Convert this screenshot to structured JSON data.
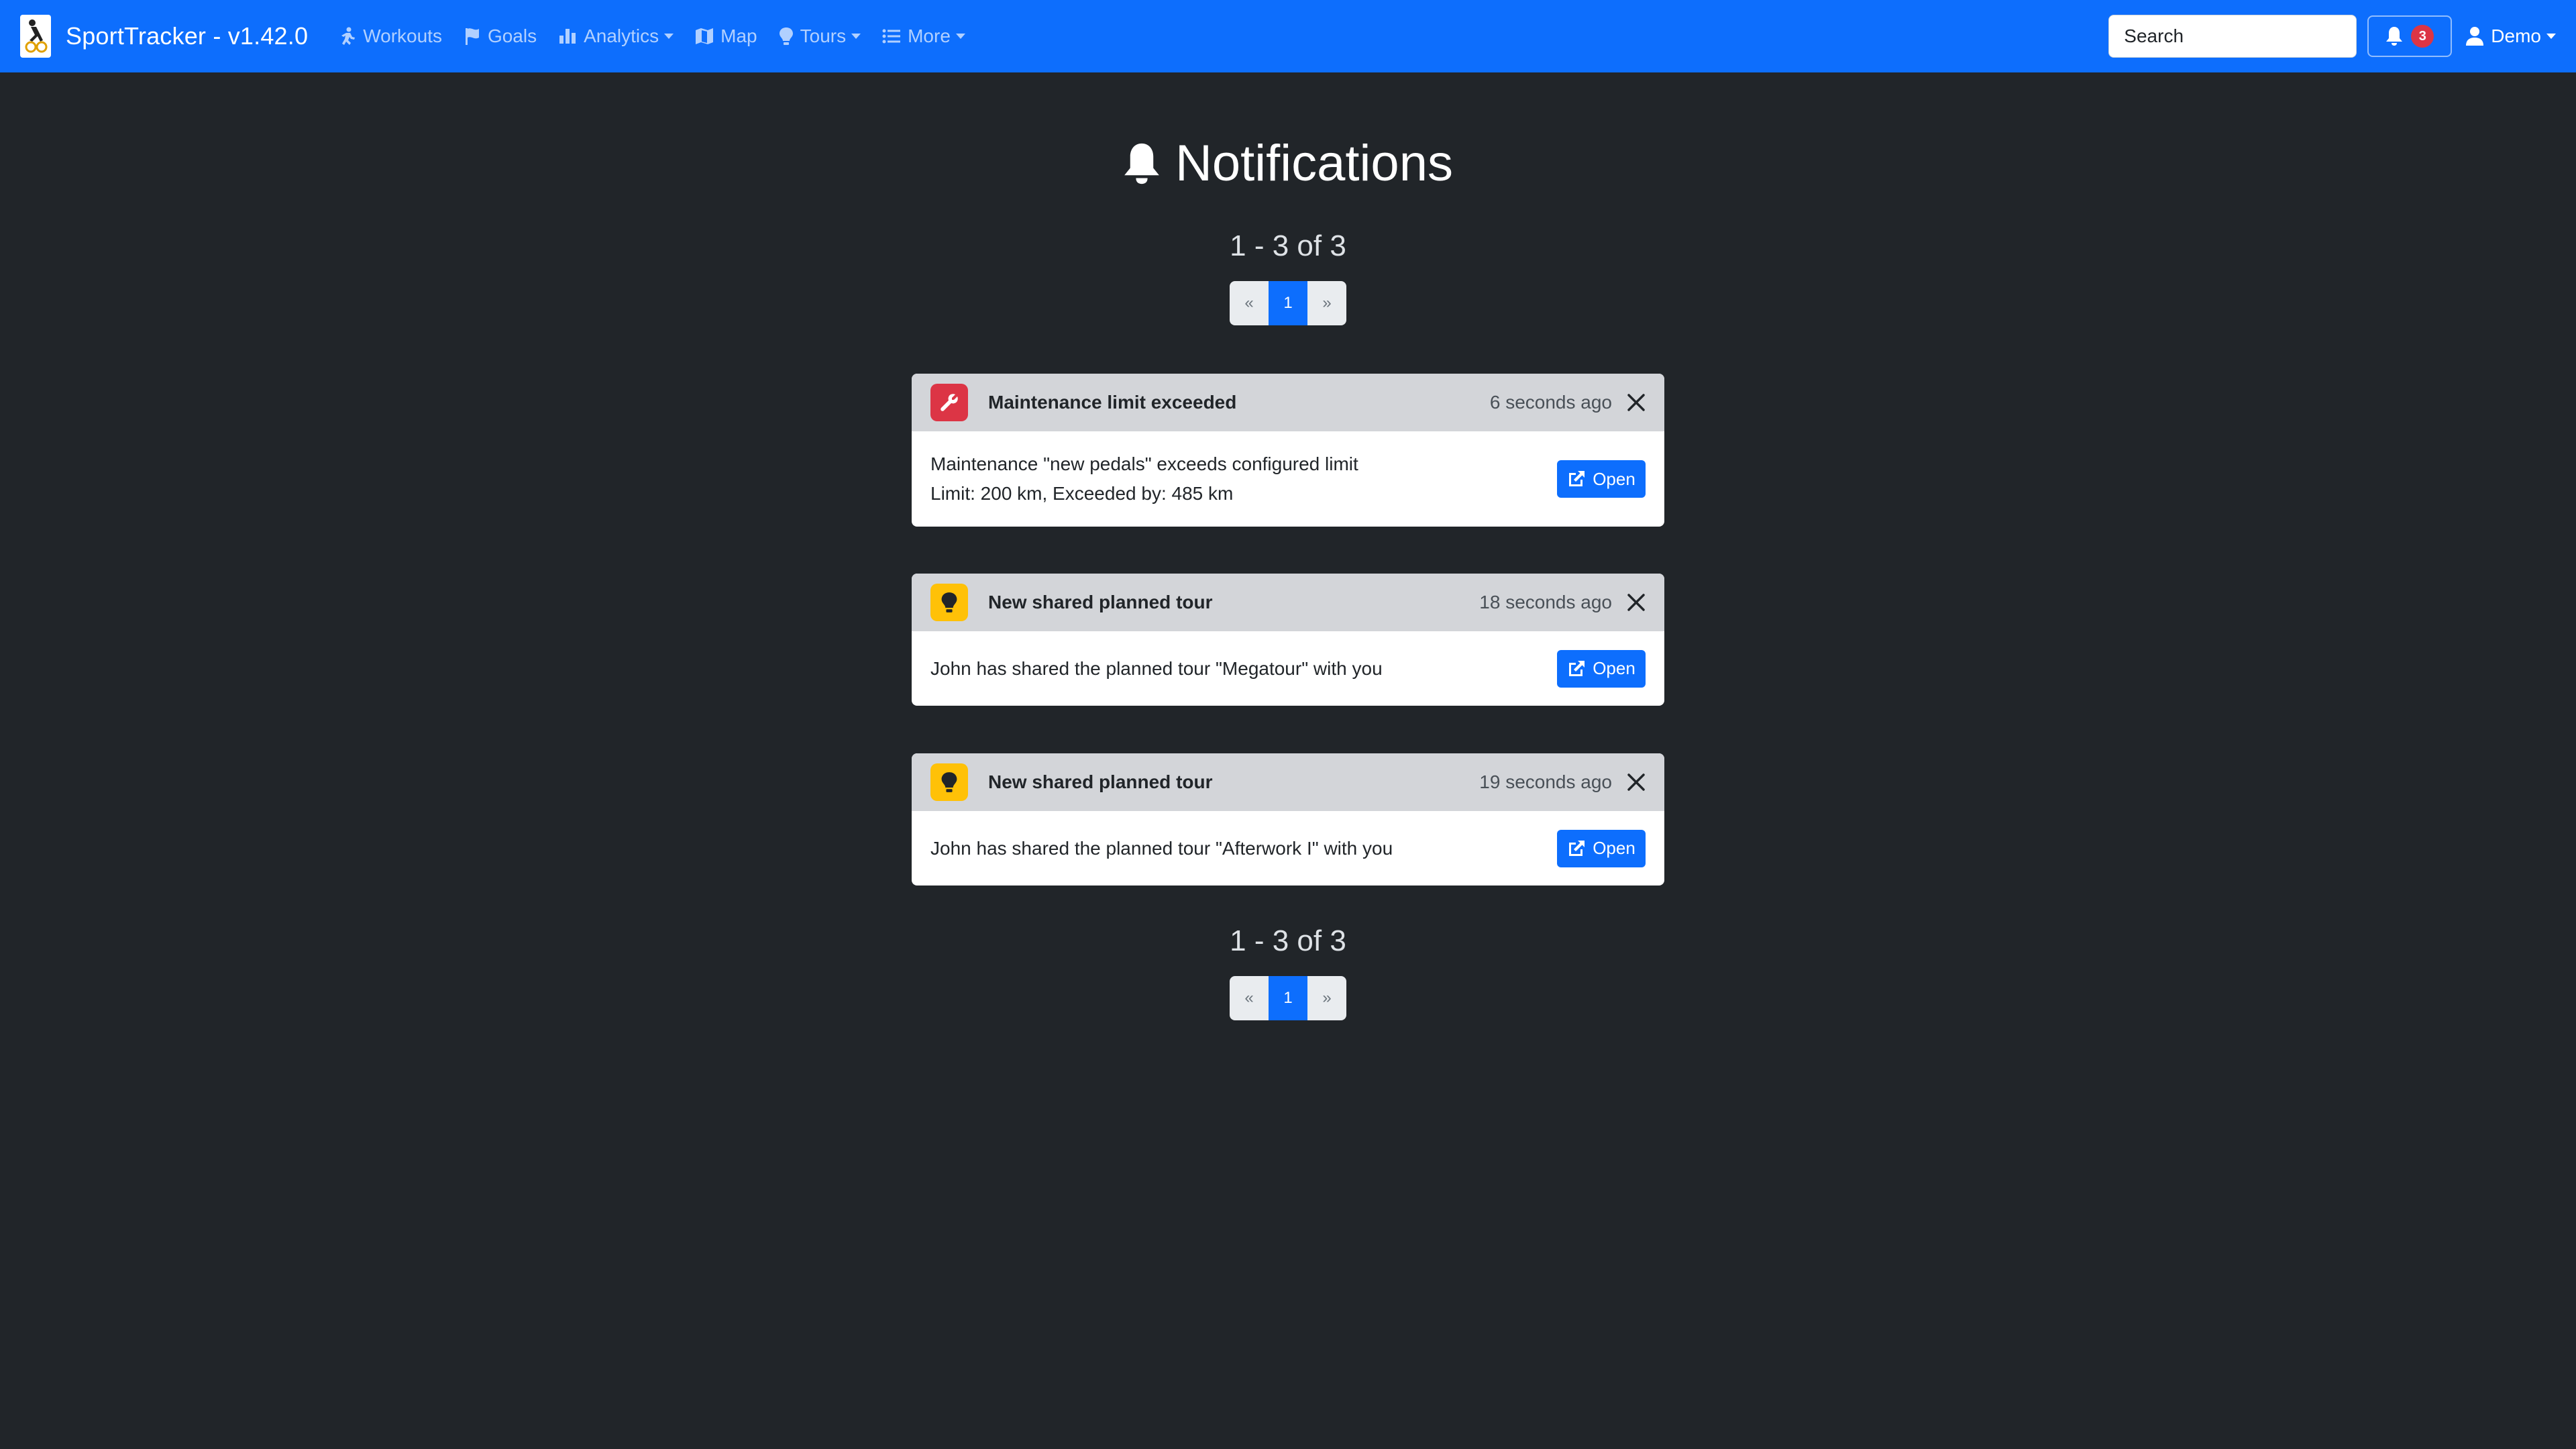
{
  "app": {
    "title": "SportTracker - v1.42.0"
  },
  "nav": {
    "items": [
      {
        "label": "Workouts",
        "icon": "runner-icon"
      },
      {
        "label": "Goals",
        "icon": "flag-icon"
      },
      {
        "label": "Analytics",
        "icon": "bar-chart-icon"
      },
      {
        "label": "Map",
        "icon": "map-icon"
      },
      {
        "label": "Tours",
        "icon": "lightbulb-icon"
      },
      {
        "label": "More",
        "icon": "list-icon"
      }
    ],
    "search_placeholder": "Search",
    "notification_count": "3",
    "user": "Demo"
  },
  "page": {
    "title": "Notifications",
    "range_text": "1 - 3 of 3",
    "pagination": {
      "prev": "«",
      "current": "1",
      "next": "»"
    }
  },
  "notifications": [
    {
      "type": "maintenance",
      "icon": "wrench-icon",
      "color": "#dc3545",
      "title": "Maintenance limit exceeded",
      "time": "6 seconds ago",
      "lines": [
        "Maintenance \"new pedals\" exceeds configured limit",
        "Limit: 200 km, Exceeded by: 485 km"
      ],
      "open_label": "Open"
    },
    {
      "type": "tour",
      "icon": "lightbulb-icon",
      "color": "#ffc107",
      "title": "New shared planned tour",
      "time": "18 seconds ago",
      "lines": [
        "John has shared the planned tour \"Megatour\" with you"
      ],
      "open_label": "Open"
    },
    {
      "type": "tour",
      "icon": "lightbulb-icon",
      "color": "#ffc107",
      "title": "New shared planned tour",
      "time": "19 seconds ago",
      "lines": [
        "John has shared the planned tour \"Afterwork I\" with you"
      ],
      "open_label": "Open"
    }
  ],
  "colors": {
    "primary": "#0d6efd",
    "background": "#212529",
    "card_header": "#d3d5d9"
  }
}
